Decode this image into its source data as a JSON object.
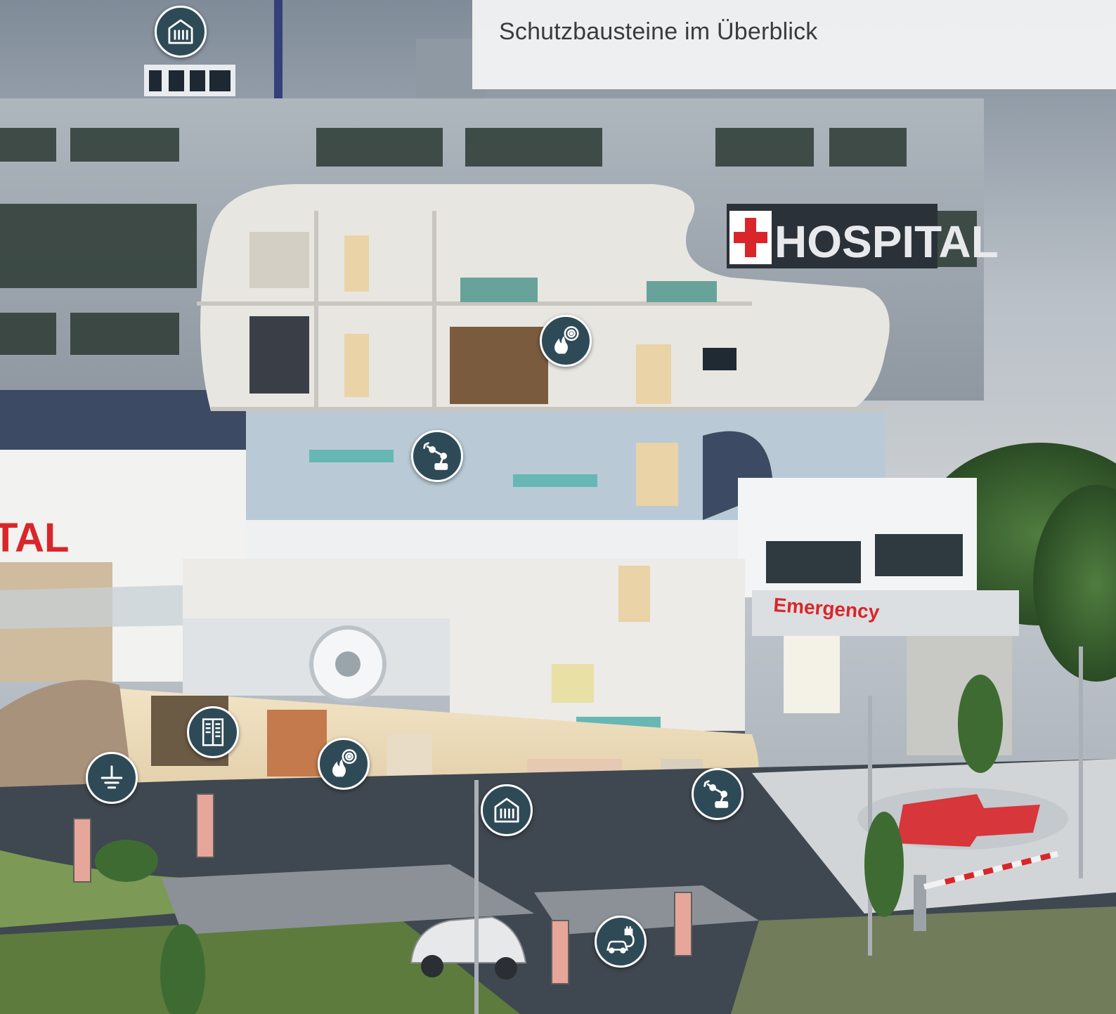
{
  "header": {
    "title": "Schutzbausteine im Überblick"
  },
  "signs": {
    "hospital": "HOSPITAL",
    "hospital_left_fragment": "TAL",
    "emergency": "Emergency"
  },
  "colors": {
    "hotspot_fill": "#2f4a57",
    "hotspot_border": "#ffffff",
    "sign_red": "#d9262a",
    "title_panel": "#f3f4f5"
  },
  "hotspots": [
    {
      "id": "roof-heating",
      "icon": "radiator-icon"
    },
    {
      "id": "floor-fire",
      "icon": "fire-smoke-detector-icon"
    },
    {
      "id": "or-robot",
      "icon": "robot-arm-icon"
    },
    {
      "id": "basement-cabinet",
      "icon": "switch-cabinet-icon"
    },
    {
      "id": "grounding",
      "icon": "ground-icon"
    },
    {
      "id": "basement-fire",
      "icon": "fire-smoke-detector-icon"
    },
    {
      "id": "basement-heating",
      "icon": "radiator-icon"
    },
    {
      "id": "basement-robot",
      "icon": "robot-arm-icon"
    },
    {
      "id": "ev-charging",
      "icon": "ev-charging-icon"
    }
  ]
}
